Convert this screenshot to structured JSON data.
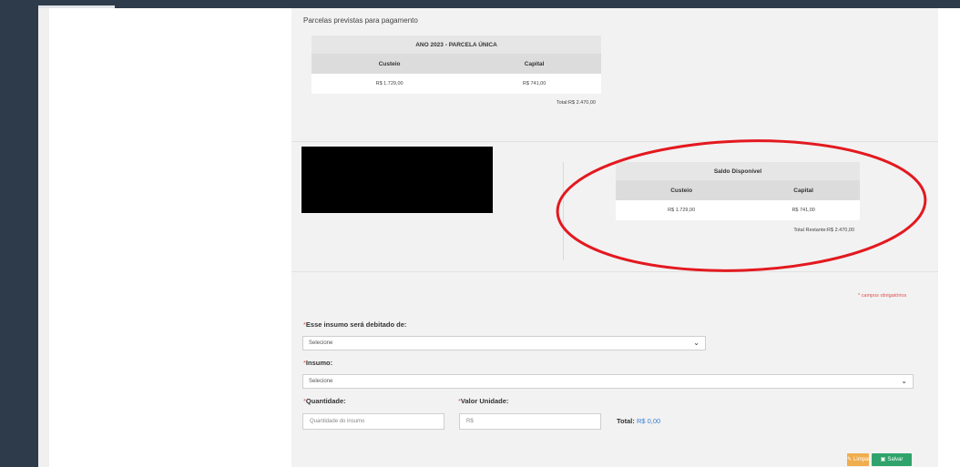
{
  "payment_section": {
    "title": "Parcelas previstas para pagamento",
    "table": {
      "caption": "ANO 2023 - PARCELA ÚNICA",
      "col_custeio": "Custeio",
      "col_capital": "Capital",
      "custeio_value": "R$ 1.729,00",
      "capital_value": "R$ 741,00",
      "total": "Total:R$ 2.470,00"
    }
  },
  "balance": {
    "caption": "Saldo Disponível",
    "col_custeio": "Custeio",
    "col_capital": "Capital",
    "custeio_value": "R$ 1.729,00",
    "capital_value": "R$ 741,00",
    "total": "Total Restante:R$ 2.470,00"
  },
  "annotation": {
    "color": "#e3191f"
  },
  "form": {
    "required_note": "* campos obrigatórios",
    "debit_label": "Esse insumo será debitado de:",
    "debit_select": "Selecione",
    "insumo_label": "Insumo:",
    "insumo_select": "Selecione",
    "quantidade_label": "Quantidade:",
    "quantidade_placeholder": "Quantidade do insumo",
    "valor_label": "Valor Unidade:",
    "valor_placeholder": "R$",
    "total_label": "Total:",
    "total_value": "R$ 0,00"
  },
  "buttons": {
    "clear_label": "Limpar",
    "save_label": "Salvar"
  },
  "colors": {
    "sidebar": "#2e3b4a",
    "clear_button": "#f0ad4e",
    "save_button": "#2fa36b",
    "required": "#d9534f",
    "link": "#3a7fd5"
  }
}
